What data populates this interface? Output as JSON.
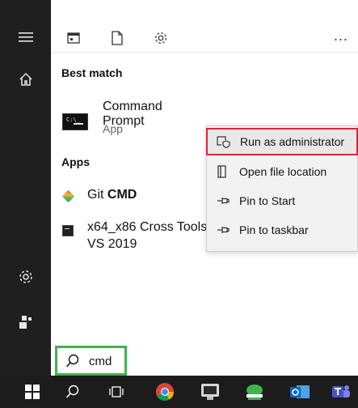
{
  "toolbar": {
    "more_label": "..."
  },
  "best_match": {
    "heading": "Best match",
    "app_name": "Command Prompt",
    "app_type": "App",
    "icon_prompt": "C:\\_"
  },
  "apps": {
    "heading": "Apps",
    "items": [
      {
        "prefix": "Git ",
        "bold": "CMD",
        "icon": "git-icon"
      },
      {
        "line1": "x64_x86 Cross Tools",
        "line2": "VS 2019",
        "icon": "vs-terminal-icon"
      }
    ]
  },
  "context_menu": {
    "items": [
      {
        "label": "Run as administrator",
        "icon": "shield-run-icon",
        "highlighted": true
      },
      {
        "label": "Open file location",
        "icon": "file-location-icon"
      },
      {
        "label": "Pin to Start",
        "icon": "pin-icon"
      },
      {
        "label": "Pin to taskbar",
        "icon": "pin-icon"
      }
    ]
  },
  "search": {
    "query": "cmd"
  },
  "colors": {
    "rail": "#1f1f1f",
    "highlight_border": "#d9283c",
    "search_border": "#3fb24f",
    "taskbar": "#1c1c1c"
  }
}
